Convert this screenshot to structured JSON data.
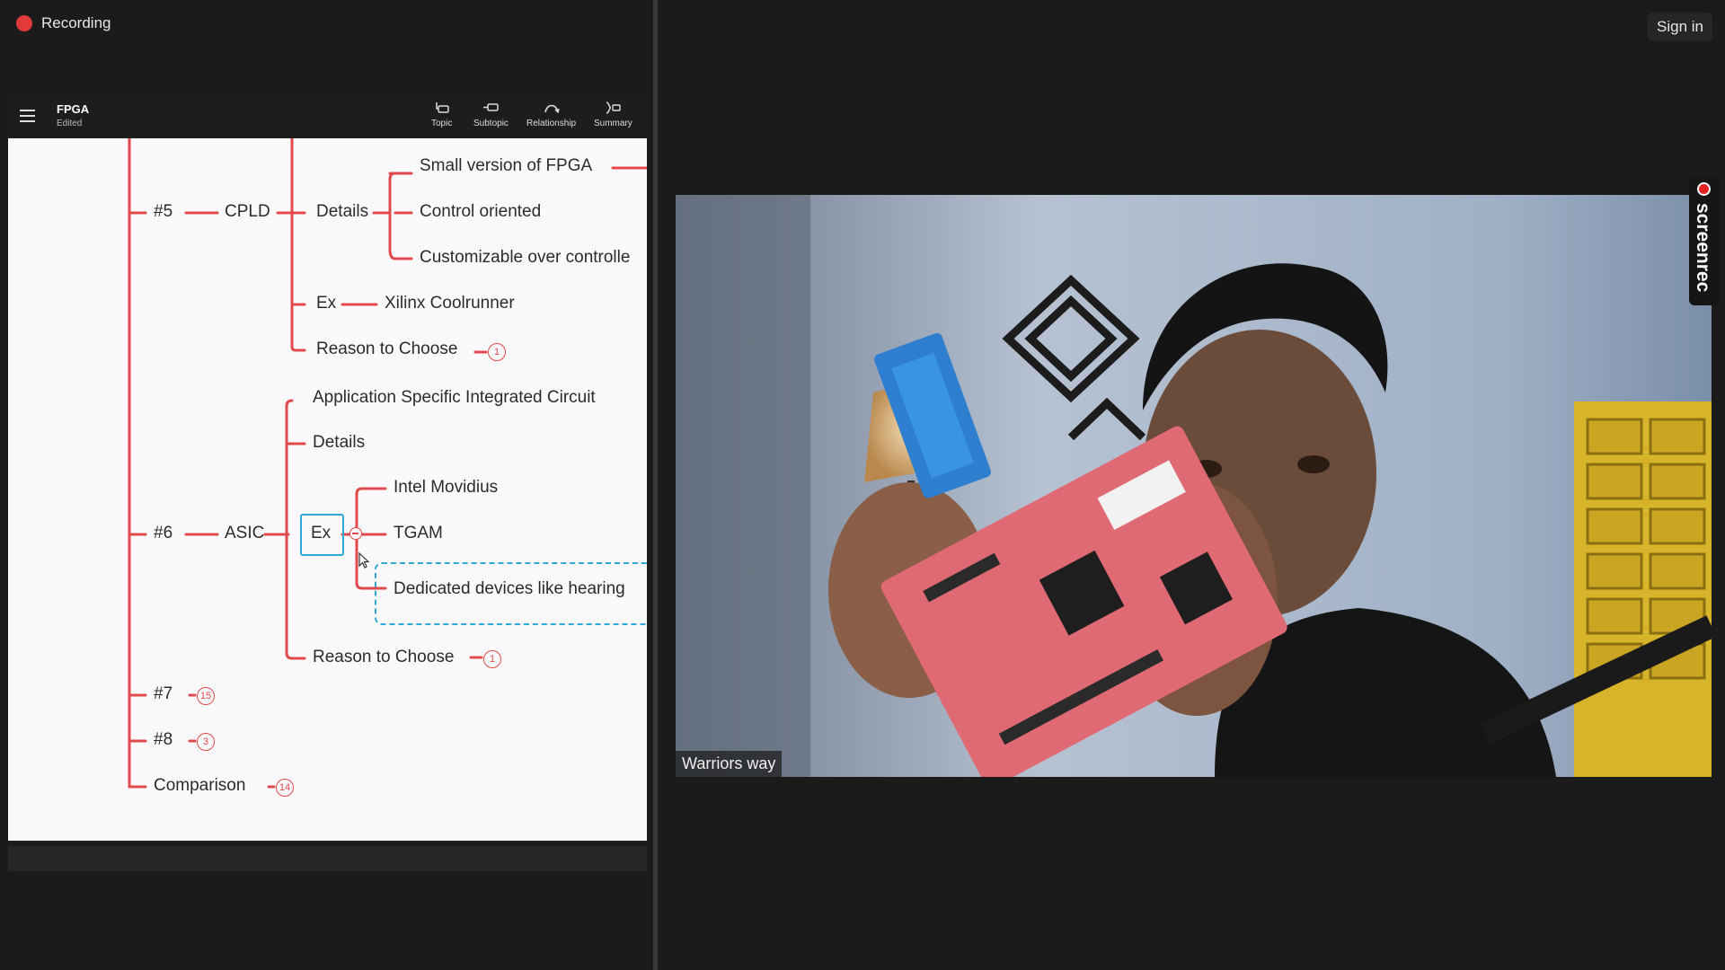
{
  "recording": {
    "label": "Recording"
  },
  "topbar": {
    "sign_in": "Sign in"
  },
  "app": {
    "title": "FPGA",
    "status": "Edited",
    "tools": [
      {
        "label": "Topic"
      },
      {
        "label": "Subtopic"
      },
      {
        "label": "Relationship"
      },
      {
        "label": "Summary"
      }
    ]
  },
  "mindmap": {
    "cpld": {
      "num": "#5",
      "name": "CPLD",
      "details": "Details",
      "detail_items": [
        "Small version of FPGA",
        "Control oriented",
        "Customizable over controlle"
      ],
      "ex": "Ex",
      "ex_item": "Xilinx Coolrunner",
      "reason": "Reason to Choose",
      "reason_badge": "1"
    },
    "asic": {
      "num": "#6",
      "name": "ASIC",
      "full": "Application Specific Integrated Circuit",
      "details": "Details",
      "ex": "Ex",
      "ex_items": [
        "Intel Movidius",
        "TGAM",
        "Dedicated devices like hearing"
      ],
      "reason": "Reason to Choose",
      "reason_badge": "1"
    },
    "n7": {
      "label": "#7",
      "badge": "15"
    },
    "n8": {
      "label": "#8",
      "badge": "3"
    },
    "comparison": {
      "label": "Comparison",
      "badge": "14"
    }
  },
  "video": {
    "caption": "Warriors way"
  },
  "overlay": {
    "brand": "screenrec"
  },
  "colors": {
    "branch": "#e04a4a",
    "selection": "#2ea8d8",
    "canvas": "#fcf9fd",
    "background": "#1b1b1b"
  }
}
